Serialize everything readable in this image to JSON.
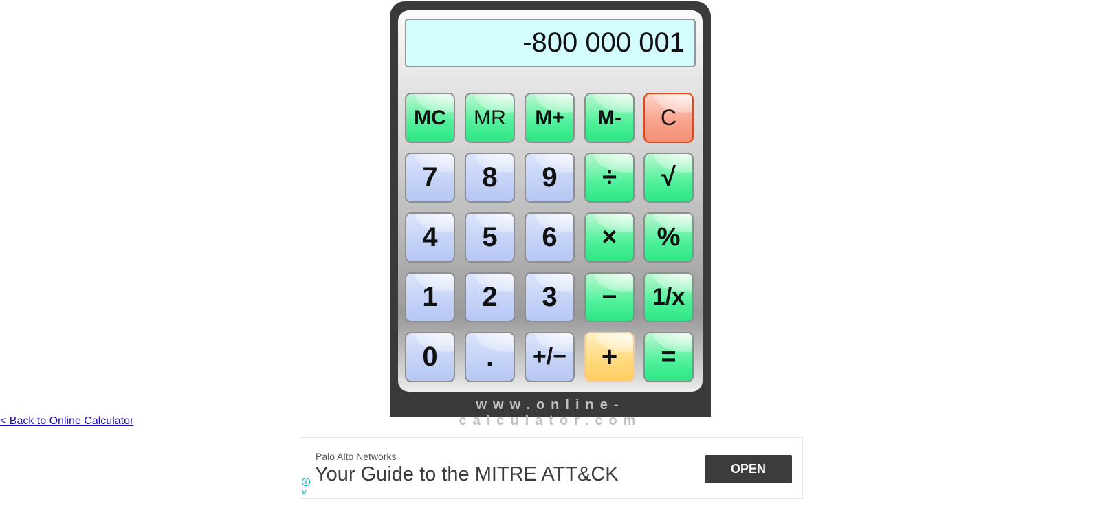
{
  "calculator": {
    "display": "-800 000 001",
    "brand": "www.online-calculator.com",
    "keys": {
      "mc": "MC",
      "mr": "MR",
      "mplus": "M+",
      "mminus": "M-",
      "clear": "C",
      "seven": "7",
      "eight": "8",
      "nine": "9",
      "divide": "÷",
      "sqrt": "√",
      "four": "4",
      "five": "5",
      "six": "6",
      "multiply": "×",
      "percent": "%",
      "one": "1",
      "two": "2",
      "three": "3",
      "minus": "−",
      "reciprocal": "1/x",
      "zero": "0",
      "decimal": ".",
      "plusminus": "+/−",
      "plus": "+",
      "equals": "="
    },
    "colors": {
      "display_bg": "#d4fdff",
      "frame": "#3a3a3a",
      "number_key": "#c5d3f7",
      "function_key": "#4ff09a",
      "clear_key": "#f7a18a",
      "active_operator": "#ffd97c"
    }
  },
  "back_link": "< Back to Online Calculator",
  "ad": {
    "sponsor": "Palo Alto Networks",
    "headline": "Your Guide to the MITRE ATT&CK",
    "cta": "OPEN",
    "info_icon": "i",
    "close_icon": "×"
  }
}
